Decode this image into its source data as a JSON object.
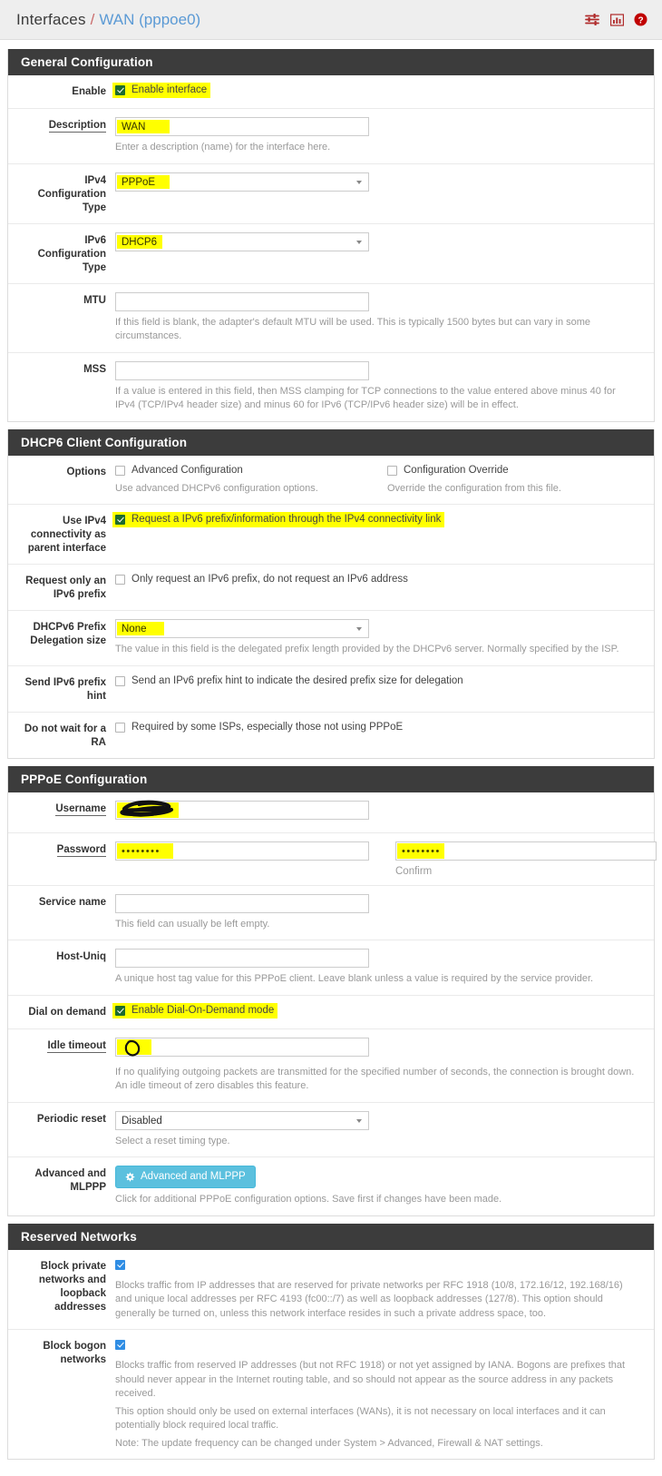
{
  "header": {
    "crumb_root": "Interfaces",
    "crumb_sep": "/",
    "crumb_current": "WAN (pppoe0)",
    "icons": [
      {
        "name": "sliders-icon",
        "color": "#b02b2b"
      },
      {
        "name": "chart-icon",
        "color": "#b02b2b"
      },
      {
        "name": "help-circle-icon",
        "color": "#c00000"
      }
    ]
  },
  "colors": {
    "panel_header_bg": "#3c3c3c",
    "highlight": "#ffff00",
    "link": "#5b9ad5",
    "accent_red": "#b02b2b",
    "checkbox_blue": "#2f8de4",
    "checkbox_green": "#1d6b2e",
    "button_blue": "#5bc0de"
  },
  "sections": {
    "general": {
      "title": "General Configuration",
      "enable": {
        "label": "Enable",
        "checkbox_label": "Enable interface",
        "checked": true,
        "highlighted": true
      },
      "description": {
        "label": "Description",
        "value": "WAN",
        "help": "Enter a description (name) for the interface here.",
        "highlighted": true,
        "required_style": true
      },
      "ipv4_type": {
        "label": "IPv4 Configuration Type",
        "value": "PPPoE",
        "highlighted": true
      },
      "ipv6_type": {
        "label": "IPv6 Configuration Type",
        "value": "DHCP6",
        "highlighted": true
      },
      "mtu": {
        "label": "MTU",
        "value": "",
        "help": "If this field is blank, the adapter's default MTU will be used. This is typically 1500 bytes but can vary in some circumstances."
      },
      "mss": {
        "label": "MSS",
        "value": "",
        "help": "If a value is entered in this field, then MSS clamping for TCP connections to the value entered above minus 40 for IPv4 (TCP/IPv4 header size) and minus 60 for IPv6 (TCP/IPv6 header size) will be in effect."
      }
    },
    "dhcp6": {
      "title": "DHCP6 Client Configuration",
      "options": {
        "label": "Options",
        "left": {
          "checkbox_label": "Advanced Configuration",
          "checked": false,
          "help": "Use advanced DHCPv6 configuration options."
        },
        "right": {
          "checkbox_label": "Configuration Override",
          "checked": false,
          "help": "Override the configuration from this file."
        }
      },
      "use_ipv4": {
        "label": "Use IPv4 connectivity as parent interface",
        "checkbox_label": "Request a IPv6 prefix/information through the IPv4 connectivity link",
        "checked": true,
        "highlighted": true
      },
      "prefix_only": {
        "label": "Request only an IPv6 prefix",
        "checkbox_label": "Only request an IPv6 prefix, do not request an IPv6 address",
        "checked": false
      },
      "delegation_size": {
        "label": "DHCPv6 Prefix Delegation size",
        "value": "None",
        "help": "The value in this field is the delegated prefix length provided by the DHCPv6 server. Normally specified by the ISP.",
        "highlighted": true
      },
      "prefix_hint": {
        "label": "Send IPv6 prefix hint",
        "checkbox_label": "Send an IPv6 prefix hint to indicate the desired prefix size for delegation",
        "checked": false
      },
      "no_ra_wait": {
        "label": "Do not wait for a RA",
        "checkbox_label": "Required by some ISPs, especially those not using PPPoE",
        "checked": false
      }
    },
    "pppoe": {
      "title": "PPPoE Configuration",
      "username": {
        "label": "Username",
        "value": "",
        "redacted": true,
        "highlighted": true,
        "required_style": true
      },
      "password": {
        "label": "Password",
        "value": "••••••••",
        "confirm_value": "••••••••",
        "confirm_label": "Confirm",
        "highlighted": true,
        "required_style": true
      },
      "service_name": {
        "label": "Service name",
        "value": "",
        "help": "This field can usually be left empty."
      },
      "host_uniq": {
        "label": "Host-Uniq",
        "value": "",
        "help": "A unique host tag value for this PPPoE client. Leave blank unless a value is required by the service provider."
      },
      "dial_on_demand": {
        "label": "Dial on demand",
        "checkbox_label": "Enable Dial-On-Demand mode",
        "checked": true,
        "highlighted": true
      },
      "idle_timeout": {
        "label": "Idle timeout",
        "value": "",
        "annotation": "0",
        "highlighted": true,
        "required_style": true,
        "help": "If no qualifying outgoing packets are transmitted for the specified number of seconds, the connection is brought down. An idle timeout of zero disables this feature."
      },
      "periodic_reset": {
        "label": "Periodic reset",
        "value": "Disabled",
        "help": "Select a reset timing type."
      },
      "advanced": {
        "label": "Advanced and MLPPP",
        "button_label": "Advanced and MLPPP",
        "help": "Click for additional PPPoE configuration options. Save first if changes have been made."
      }
    },
    "reserved": {
      "title": "Reserved Networks",
      "block_private": {
        "label": "Block private networks and loopback addresses",
        "checked": true,
        "help": "Blocks traffic from IP addresses that are reserved for private networks per RFC 1918 (10/8, 172.16/12, 192.168/16) and unique local addresses per RFC 4193 (fc00::/7) as well as loopback addresses (127/8). This option should generally be turned on, unless this network interface resides in such a private address space, too."
      },
      "block_bogon": {
        "label": "Block bogon networks",
        "checked": true,
        "help_lines": [
          "Blocks traffic from reserved IP addresses (but not RFC 1918) or not yet assigned by IANA. Bogons are prefixes that should never appear in the Internet routing table, and so should not appear as the source address in any packets received.",
          "This option should only be used on external interfaces (WANs), it is not necessary on local interfaces and it can potentially block required local traffic.",
          "Note: The update frequency can be changed under System > Advanced, Firewall & NAT settings."
        ]
      }
    }
  }
}
